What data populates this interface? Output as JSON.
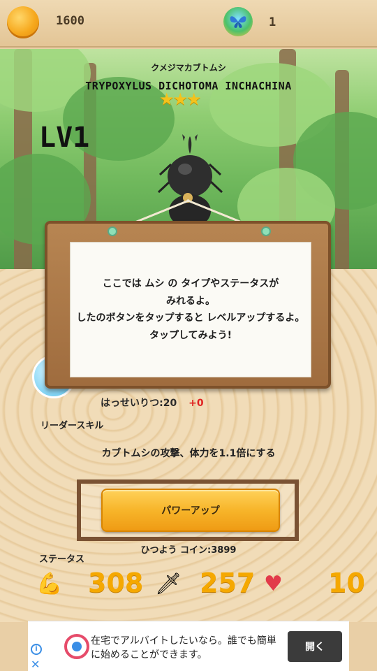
{
  "header": {
    "coin_count": "1600",
    "butterfly_count": "1"
  },
  "insect": {
    "jp_name": "クメジマカブトムシ",
    "latin_name": "TRYPOXYLUS DICHOTOMA INCHACHINA",
    "stars": "★★★",
    "level": "LV1"
  },
  "tutorial": {
    "line1": "ここでは ムシ の タイプやステータスが",
    "line2": "みれるよ。",
    "line3": "したのボタンをタップすると レベルアップするよ。",
    "line4": "タップしてみよう!"
  },
  "stats": {
    "hassei_label": "はっせいりつ:20",
    "hassei_plus": "+0",
    "leader_skill_label": "リーダースキル",
    "leader_skill_desc": "カブトムシの攻撃、体力を1.1倍にする",
    "power_up_label": "パワーアップ",
    "cost_label": "ひつよう コイン:3899",
    "status_label": "ステータス",
    "hp": "308",
    "attack": "257",
    "third": "10"
  },
  "ad": {
    "text": "在宅でアルバイトしたいなら。誰でも簡単に始めることができます。",
    "button": "開く"
  },
  "colors": {
    "accent": "#f5a800",
    "plus_red": "#e02020"
  }
}
